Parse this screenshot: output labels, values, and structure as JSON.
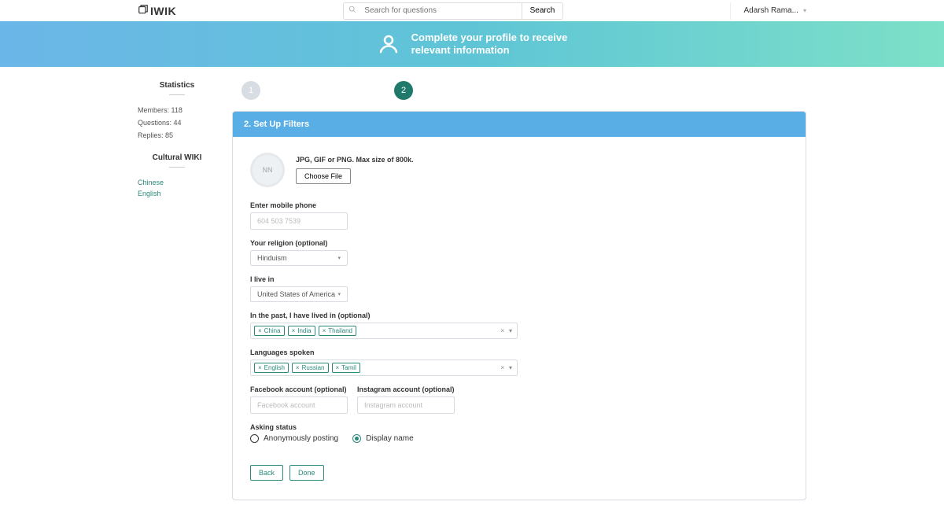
{
  "header": {
    "logo": "IWIK",
    "search_placeholder": "Search for questions",
    "search_button": "Search",
    "user_name": "Adarsh Rama..."
  },
  "banner": {
    "line1": "Complete your profile to receive",
    "line2": "relevant information"
  },
  "sidebar": {
    "stats_title": "Statistics",
    "members_label": "Members:",
    "members_value": "118",
    "questions_label": "Questions:",
    "questions_value": "44",
    "replies_label": "Replies:",
    "replies_value": "85",
    "wiki_title": "Cultural WIKI",
    "wiki_links": [
      "Chinese",
      "English"
    ]
  },
  "steps": {
    "step1": "1",
    "step2": "2"
  },
  "card": {
    "title": "2. Set Up Filters",
    "avatar_initials": "NN",
    "upload_hint": "JPG, GIF or PNG. Max size of 800k.",
    "choose_file": "Choose File",
    "phone_label": "Enter mobile phone",
    "phone_placeholder": "604 503 7539",
    "religion_label": "Your religion (optional)",
    "religion_value": "Hinduism",
    "livein_label": "I live in",
    "livein_value": "United States of America",
    "past_label": "In the past, I have lived in (optional)",
    "past_tags": [
      "China",
      "India",
      "Thailand"
    ],
    "lang_label": "Languages spoken",
    "lang_tags": [
      "English",
      "Russian",
      "Tamil"
    ],
    "fb_label": "Facebook account (optional)",
    "fb_placeholder": "Facebook account",
    "ig_label": "Instagram account (optional)",
    "ig_placeholder": "Instagram account",
    "asking_label": "Asking status",
    "radio_anon": "Anonymously posting",
    "radio_display": "Display name",
    "back": "Back",
    "done": "Done"
  }
}
